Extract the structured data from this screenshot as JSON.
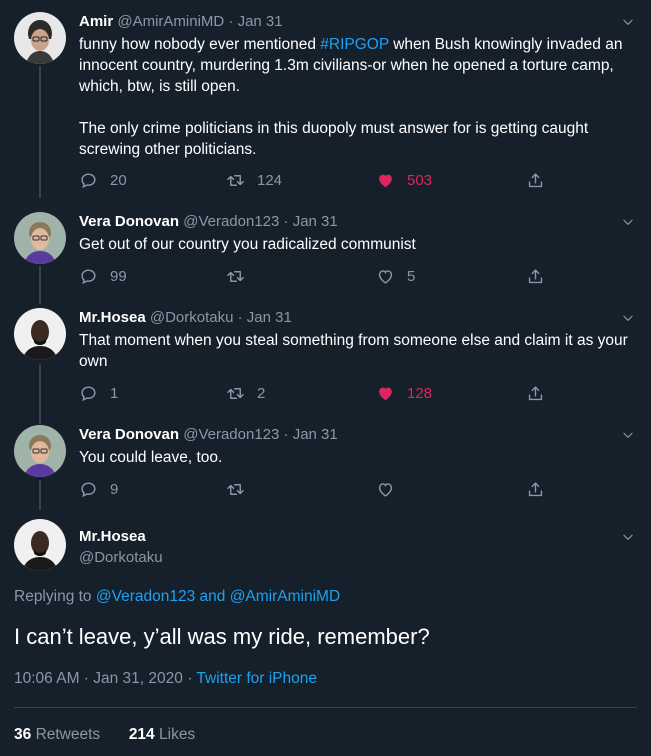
{
  "colors": {
    "background": "#15202b",
    "accent": "#1da1f2",
    "like": "#e0245e",
    "muted": "#8899a6"
  },
  "tweets": [
    {
      "name": "Amir",
      "handle": "@AmirAminiMD",
      "date": "· Jan 31",
      "text_before": "funny how nobody ever mentioned ",
      "hashtag": "#RIPGOP",
      "text_after": " when Bush knowingly invaded an innocent country, murdering 1.3m civilians-or when he opened a torture camp, which, btw, is still open.",
      "text_para2": "The only crime politicians in this duopoly must answer for is getting caught screwing other politicians.",
      "replies": "20",
      "retweets": "124",
      "likes": "503",
      "liked": true
    },
    {
      "name": "Vera Donovan",
      "handle": "@Veradon123",
      "date": "· Jan 31",
      "text": "Get out of our country you radicalized communist",
      "replies": "99",
      "retweets": "",
      "likes": "5",
      "liked": false
    },
    {
      "name": "Mr.Hosea",
      "handle": "@Dorkotaku",
      "date": "· Jan 31",
      "text": "That moment when you steal something from someone else and claim it as your own",
      "replies": "1",
      "retweets": "2",
      "likes": "128",
      "liked": true
    },
    {
      "name": "Vera Donovan",
      "handle": "@Veradon123",
      "date": "· Jan 31",
      "text": "You could leave, too.",
      "replies": "9",
      "retweets": "",
      "likes": "",
      "liked": false
    }
  ],
  "main": {
    "name": "Mr.Hosea",
    "handle": "@Dorkotaku",
    "replying_prefix": "Replying to ",
    "replying_user1": "@Veradon123",
    "replying_and": " and ",
    "replying_user2": "@AmirAminiMD",
    "text": "I can’t leave, y’all was my ride, remember?",
    "time": "10:06 AM · Jan 31, 2020 · ",
    "client": "Twitter for iPhone",
    "retweets_count": "36",
    "retweets_label": "Retweets",
    "likes_count": "214",
    "likes_label": "Likes"
  },
  "icons": {
    "reply": "reply-icon",
    "retweet": "retweet-icon",
    "like": "heart-icon",
    "share": "share-icon",
    "caret": "chevron-down-icon"
  }
}
